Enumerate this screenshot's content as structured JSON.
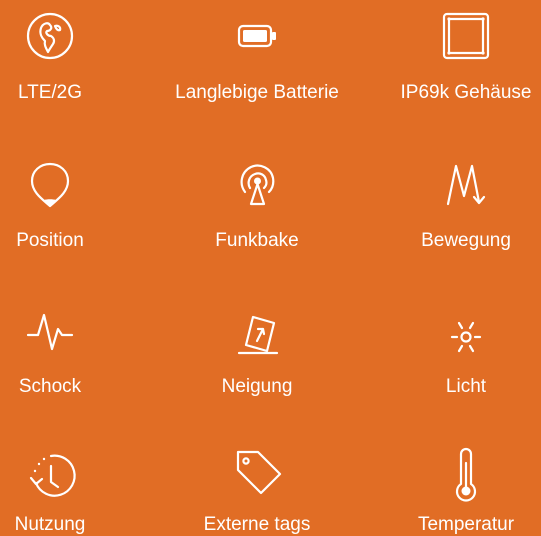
{
  "features": [
    {
      "label": "LTE/2G",
      "icon": "globe-icon"
    },
    {
      "label": "Langlebige Batterie",
      "icon": "battery-icon"
    },
    {
      "label": "IP69k Gehäuse",
      "icon": "enclosure-icon"
    },
    {
      "label": "Position",
      "icon": "location-pin-icon"
    },
    {
      "label": "Funkbake",
      "icon": "radio-beacon-icon"
    },
    {
      "label": "Bewegung",
      "icon": "movement-icon"
    },
    {
      "label": "Schock",
      "icon": "shock-pulse-icon"
    },
    {
      "label": "Neigung",
      "icon": "tilt-icon"
    },
    {
      "label": "Licht",
      "icon": "light-icon"
    },
    {
      "label": "Nutzung",
      "icon": "usage-clock-icon"
    },
    {
      "label": "Externe tags",
      "icon": "tag-icon"
    },
    {
      "label": "Temperatur",
      "icon": "thermometer-icon"
    }
  ],
  "colors": {
    "background": "#E16D25",
    "foreground": "#FFFFFF"
  }
}
